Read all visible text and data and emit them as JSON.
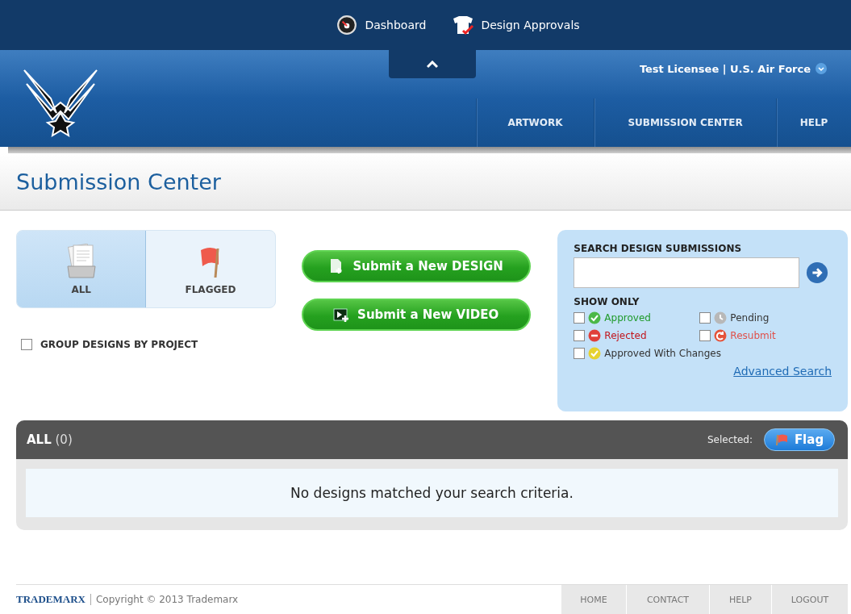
{
  "top_nav": [
    {
      "label": "Dashboard",
      "kind": "dashboard"
    },
    {
      "label": "Design Approvals",
      "kind": "approvals"
    }
  ],
  "user_menu": {
    "label": "Test Licensee | U.S. Air Force"
  },
  "main_nav": [
    {
      "label": "ARTWORK",
      "selected": false
    },
    {
      "label": "SUBMISSION CENTER",
      "selected": false
    },
    {
      "label": "HELP",
      "selected": false
    }
  ],
  "page_title": "Submission Center",
  "view_tabs": [
    {
      "label": "ALL",
      "kind": "all",
      "selected": true
    },
    {
      "label": "FLAGGED",
      "kind": "flagged",
      "selected": false
    }
  ],
  "group_by_project": {
    "label": "GROUP DESIGNS BY PROJECT",
    "checked": false
  },
  "submit_buttons": [
    {
      "label": "Submit a New DESIGN",
      "kind": "design"
    },
    {
      "label": "Submit a New VIDEO",
      "kind": "video"
    }
  ],
  "search": {
    "title": "SEARCH DESIGN SUBMISSIONS",
    "show_only": "SHOW ONLY",
    "advanced_link": "Advanced Search",
    "filters": [
      {
        "label": "Approved",
        "kind": "approved",
        "checked": false
      },
      {
        "label": "Pending",
        "kind": "pending",
        "checked": false
      },
      {
        "label": "Rejected",
        "kind": "rejected",
        "checked": false
      },
      {
        "label": "Resubmit",
        "kind": "resubmit",
        "checked": false
      },
      {
        "label": "Approved With Changes",
        "kind": "changes",
        "checked": false
      }
    ]
  },
  "results": {
    "title": "ALL",
    "count": "(0)",
    "selected_label": "Selected:",
    "flag_button": "Flag",
    "empty_message": "No designs matched your search criteria."
  },
  "footer": {
    "brand": "TRADEMARX",
    "copyright": "Copyright © 2013 Trademarx",
    "links": [
      "HOME",
      "CONTACT",
      "HELP",
      "LOGOUT"
    ]
  }
}
